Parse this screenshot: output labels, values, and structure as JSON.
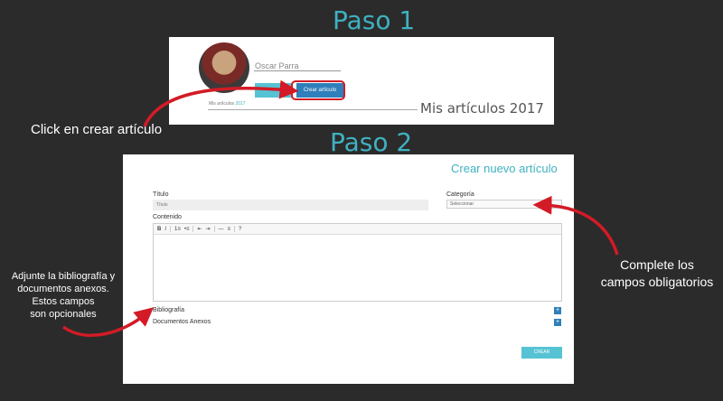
{
  "steps": {
    "step1_title": "Paso 1",
    "step2_title": "Paso 2"
  },
  "profile": {
    "name": "Oscar Parra",
    "tab_label": "4",
    "create_button": "Crear artículo",
    "my_articles_small_prefix": "Mis artículos",
    "my_articles_small_year": "2017",
    "my_articles_big": "Mis artículos 2017"
  },
  "callouts": {
    "click": "Click en crear artículo",
    "complete_line1": "Complete los",
    "complete_line2": "campos obligatorios",
    "adjunte_line1": "Adjunte la bibliografía y",
    "adjunte_line2": "documentos anexos.",
    "adjunte_line3": "Estos campos",
    "adjunte_line4": "son opcionales"
  },
  "form": {
    "title": "Crear nuevo artículo",
    "titulo_label": "Título",
    "titulo_placeholder": "Título",
    "categoria_label": "Categoría",
    "categoria_value": "Seleccionar",
    "contenido_label": "Contenido",
    "toolbar": [
      "B",
      "I",
      "1≡",
      "•≡",
      "⇤",
      "⇥",
      "—",
      "≡",
      "?"
    ],
    "bibliografia_label": "Bibliografía",
    "documentos_label": "Documentos Anexos",
    "add_symbol": "+",
    "submit_label": "CREAR"
  },
  "colors": {
    "accent": "#3fb1c1",
    "primary_button": "#2e7fba",
    "arrow_red": "#d21b26",
    "background": "#2b2b2b"
  },
  "icons": [
    "user-avatar",
    "arrow-icon",
    "plus-icon"
  ]
}
